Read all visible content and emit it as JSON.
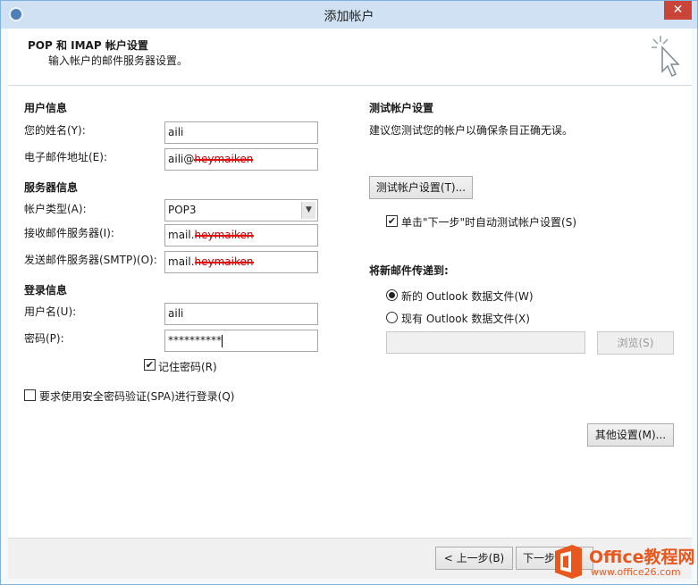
{
  "window": {
    "title": "添加帐户",
    "close_label": "✕"
  },
  "header": {
    "title": "POP 和 IMAP 帐户设置",
    "subtitle": "输入帐户的邮件服务器设置。"
  },
  "user_info": {
    "heading": "用户信息",
    "name_label": "您的姓名(Y):",
    "name_value": "aili",
    "email_label": "电子邮件地址(E):",
    "email_prefix": "aili@",
    "email_redacted": "heymaiken"
  },
  "server_info": {
    "heading": "服务器信息",
    "account_type_label": "帐户类型(A):",
    "account_type_value": "POP3",
    "incoming_label": "接收邮件服务器(I):",
    "incoming_prefix": "mail.",
    "incoming_redacted": "heymaiken",
    "outgoing_label": "发送邮件服务器(SMTP)(O):",
    "outgoing_prefix": "mail.",
    "outgoing_redacted": "heymaiken"
  },
  "login_info": {
    "heading": "登录信息",
    "username_label": "用户名(U):",
    "username_value": "aili",
    "password_label": "密码(P):",
    "password_value": "**********",
    "remember_label": "记住密码(R)",
    "remember_checked": true,
    "spa_label": "要求使用安全密码验证(SPA)进行登录(Q)",
    "spa_checked": false
  },
  "test_settings": {
    "heading": "测试帐户设置",
    "description": "建议您测试您的帐户以确保条目正确无误。",
    "test_button": "测试帐户设置(T)...",
    "auto_test_label": "单击\"下一步\"时自动测试帐户设置(S)",
    "auto_test_checked": true
  },
  "delivery": {
    "heading": "将新邮件传递到:",
    "new_file_label": "新的 Outlook 数据文件(W)",
    "existing_file_label": "现有 Outlook 数据文件(X)",
    "path_value": "",
    "browse_button": "浏览(S)"
  },
  "more_settings_button": "其他设置(M)...",
  "footer": {
    "back_button": "< 上一步(B)",
    "next_button": "下一步"
  },
  "watermark": {
    "brand": "Office教程网",
    "url": "www.office26.com"
  },
  "colors": {
    "title_bar": "#cfe1f3",
    "close": "#c9453a",
    "brand_orange": "#e8571e"
  }
}
